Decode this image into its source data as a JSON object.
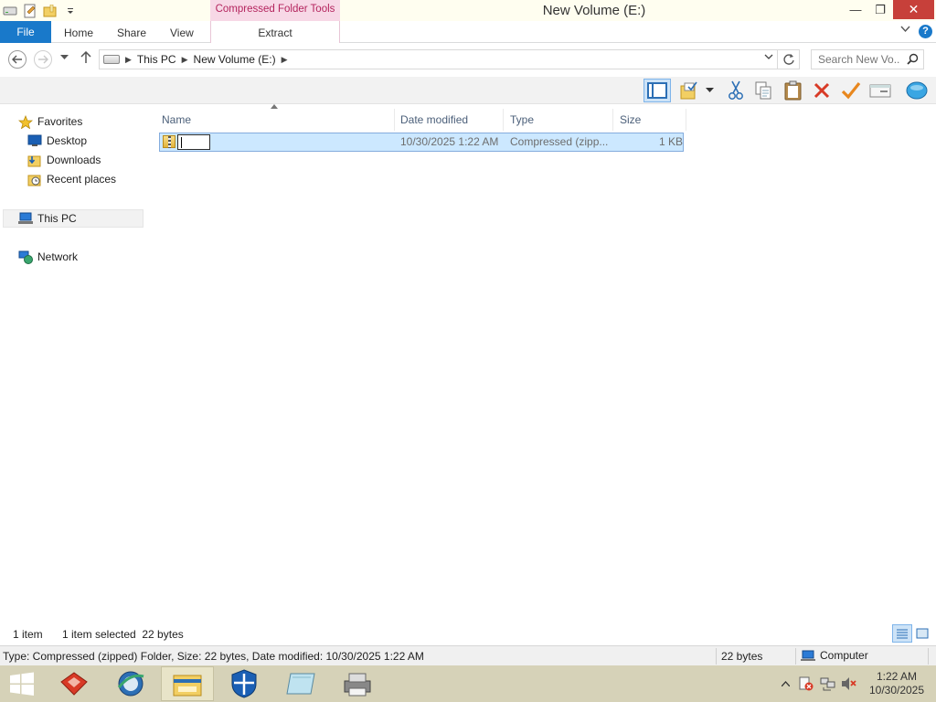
{
  "window": {
    "title": "New Volume (E:)",
    "minimize_glyph": "—",
    "restore_glyph": "❐",
    "close_glyph": "✕"
  },
  "ribbon": {
    "contextual_header": "Compressed Folder Tools",
    "tabs": [
      "File",
      "Home",
      "Share",
      "View"
    ],
    "contextual_tab": "Extract",
    "help_glyph": "?"
  },
  "address": {
    "breadcrumbs": [
      "This PC",
      "New Volume (E:)"
    ],
    "search_placeholder": "Search New Vo..."
  },
  "navpane": {
    "favorites": "Favorites",
    "favorite_items": [
      "Desktop",
      "Downloads",
      "Recent places"
    ],
    "this_pc": "This PC",
    "network": "Network"
  },
  "columns": {
    "name": "Name",
    "date_modified": "Date modified",
    "type": "Type",
    "size": "Size"
  },
  "files": [
    {
      "name": "",
      "date_modified": "10/30/2025 1:22 AM",
      "type": "Compressed (zipp...",
      "size": "1 KB",
      "selected": true,
      "renaming": true
    }
  ],
  "statusbar": {
    "item_count": "1 item",
    "selected_info": "1 item selected  22 bytes"
  },
  "detailsbar": {
    "description": "Type: Compressed (zipped) Folder, Size: 22 bytes, Date modified: 10/30/2025 1:22 AM",
    "size": "22 bytes",
    "location": "Computer"
  },
  "taskbar": {
    "time": "1:22 AM",
    "date": "10/30/2025"
  },
  "colors": {
    "file_tab": "#1979ca",
    "contextual_header": "#f7d8e6",
    "selection": "#cce8ff",
    "close_button": "#c7403a",
    "taskbar": "#d6d2b8"
  }
}
